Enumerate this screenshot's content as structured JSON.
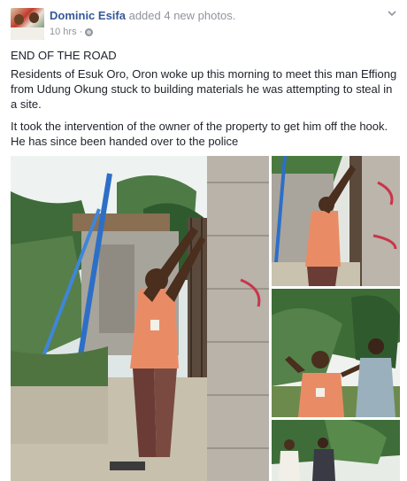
{
  "post": {
    "author": "Dominic Esifa",
    "action": "added 4 new photos.",
    "timestamp": "10 hrs",
    "separator": "·",
    "privacy_icon": "globe-icon",
    "menu_icon": "chevron-down-icon",
    "paragraphs": [
      "END OF THE ROAD",
      "Residents of Esuk Oro, Oron woke up this morning to meet this man Effiong from Udung Okung stuck to building materials he was attempting to steal in a site.",
      "It took the intervention of the owner of the property to get him off the hook. He has since been handed over to the police"
    ]
  },
  "colors": {
    "link": "#365899",
    "muted": "#90949c",
    "text": "#1d2129"
  },
  "photos": [
    {
      "name": "main-photo"
    },
    {
      "name": "top-right-photo"
    },
    {
      "name": "middle-right-photo"
    },
    {
      "name": "bottom-right-photo"
    }
  ]
}
